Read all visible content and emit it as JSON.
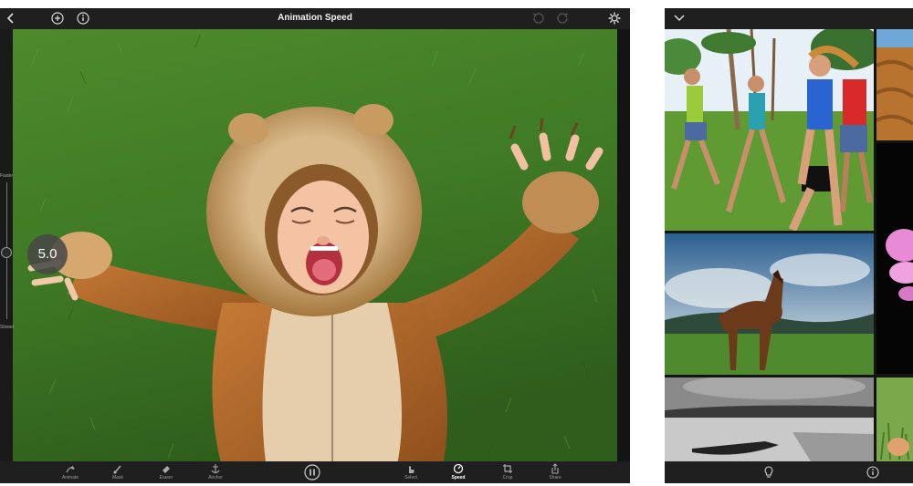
{
  "editor": {
    "title": "Animation Speed",
    "back_icon": "back-chevron-icon",
    "add_icon": "add-circle-icon",
    "info_icon": "info-circle-icon",
    "undo_icon": "undo-icon",
    "redo_icon": "redo-icon",
    "settings_icon": "gear-icon",
    "slider": {
      "top_label": "Faster",
      "bottom_label": "Slower",
      "value": "5.0"
    },
    "play_pause_icon": "pause-icon",
    "tools": [
      {
        "label": "Animate",
        "icon": "animate-icon"
      },
      {
        "label": "Mask",
        "icon": "brush-icon"
      },
      {
        "label": "Eraser",
        "icon": "eraser-icon"
      },
      {
        "label": "Anchor",
        "icon": "anchor-icon"
      },
      {
        "label": "Select",
        "icon": "hand-pointer-icon"
      },
      {
        "label": "Speed",
        "icon": "speedometer-icon",
        "active": true
      },
      {
        "label": "Crop",
        "icon": "crop-icon"
      },
      {
        "label": "Share",
        "icon": "share-icon"
      }
    ]
  },
  "gallery": {
    "collapse_icon": "chevron-down-icon",
    "bottom_left_icon": "lightbulb-icon",
    "bottom_right_icon": "info-circle-icon",
    "thumbnails": [
      {
        "name": "beach-runners-photo"
      },
      {
        "name": "horse-sky-photo"
      },
      {
        "name": "rowboat-lake-photo"
      },
      {
        "name": "canyon-rocks-photo"
      },
      {
        "name": "pink-flower-photo"
      },
      {
        "name": "green-grass-photo"
      }
    ]
  },
  "colors": {
    "bar": "#1f1f1f",
    "background": "#141414",
    "grass": "#3f7a25",
    "costume": "#b0662a"
  }
}
